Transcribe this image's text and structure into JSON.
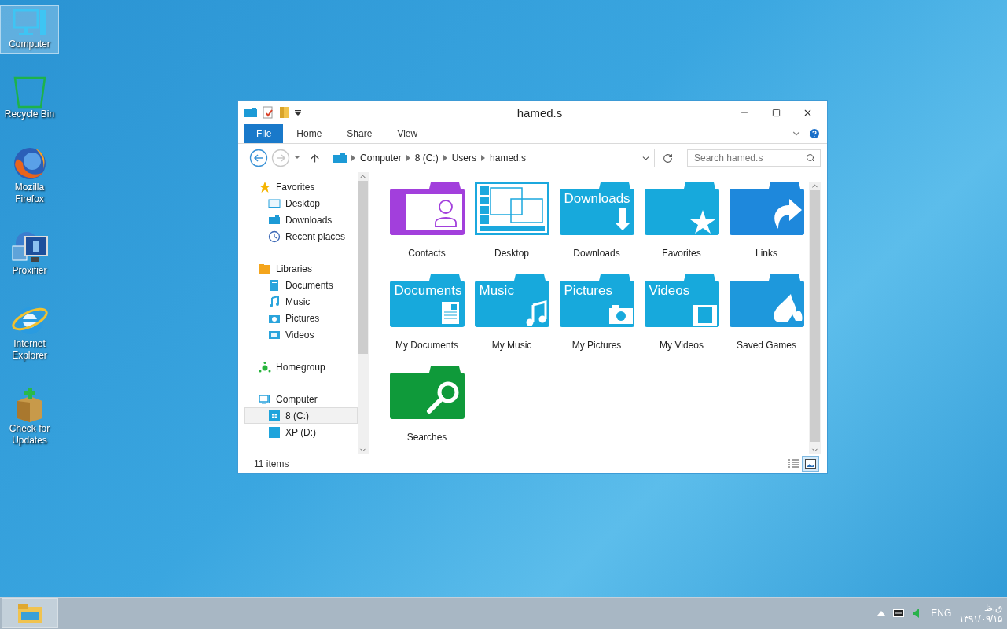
{
  "desktop_icons": [
    {
      "label": "Computer",
      "kind": "computer",
      "selected": true
    },
    {
      "label": "Recycle Bin",
      "kind": "recycle",
      "selected": false
    },
    {
      "label": "Mozilla Firefox",
      "kind": "firefox",
      "selected": false
    },
    {
      "label": "Proxifier",
      "kind": "proxifier",
      "selected": false
    },
    {
      "label": "Internet Explorer",
      "kind": "ie",
      "selected": false
    },
    {
      "label": "Check for Updates",
      "kind": "updates",
      "selected": false
    }
  ],
  "window": {
    "title": "hamed.s",
    "ribbon_tabs": [
      {
        "label": "File",
        "selected": true
      },
      {
        "label": "Home",
        "selected": false
      },
      {
        "label": "Share",
        "selected": false
      },
      {
        "label": "View",
        "selected": false
      }
    ],
    "address": {
      "crumbs": [
        "Computer",
        "8 (C:)",
        "Users",
        "hamed.s"
      ]
    },
    "search": {
      "placeholder": "Search hamed.s"
    },
    "nav": [
      {
        "label": "Favorites",
        "kind": "favorites",
        "selected": false,
        "children": [
          {
            "label": "Desktop",
            "kind": "desktop",
            "selected": false
          },
          {
            "label": "Downloads",
            "kind": "downloads",
            "selected": false
          },
          {
            "label": "Recent places",
            "kind": "recent",
            "selected": false
          }
        ]
      },
      {
        "label": "Libraries",
        "kind": "libraries",
        "selected": false,
        "children": [
          {
            "label": "Documents",
            "kind": "documents",
            "selected": false
          },
          {
            "label": "Music",
            "kind": "music",
            "selected": false
          },
          {
            "label": "Pictures",
            "kind": "pictures",
            "selected": false
          },
          {
            "label": "Videos",
            "kind": "videos",
            "selected": false
          }
        ]
      },
      {
        "label": "Homegroup",
        "kind": "homegroup",
        "selected": false
      },
      {
        "label": "Computer",
        "kind": "computer",
        "selected": false,
        "children": [
          {
            "label": "8 (C:)",
            "kind": "windows-drive",
            "selected": true
          },
          {
            "label": "XP (D:)",
            "kind": "drive",
            "selected": false
          }
        ]
      }
    ],
    "items": [
      {
        "label": "Contacts",
        "kind": "contacts",
        "color": "#a23fdc"
      },
      {
        "label": "Desktop",
        "kind": "desktop",
        "color": "#1ba8de"
      },
      {
        "label": "Downloads",
        "kind": "downloads",
        "color": "#17a9dc",
        "folder_text": "Downloads"
      },
      {
        "label": "Favorites",
        "kind": "favorites",
        "color": "#17a9dc"
      },
      {
        "label": "Links",
        "kind": "links",
        "color": "#1e88dc"
      },
      {
        "label": "My Documents",
        "kind": "documents",
        "color": "#17a9dc",
        "folder_text": "Documents"
      },
      {
        "label": "My Music",
        "kind": "music",
        "color": "#17a9dc",
        "folder_text": "Music"
      },
      {
        "label": "My Pictures",
        "kind": "pictures",
        "color": "#17a9dc",
        "folder_text": "Pictures"
      },
      {
        "label": "My Videos",
        "kind": "videos",
        "color": "#17a9dc",
        "folder_text": "Videos"
      },
      {
        "label": "Saved Games",
        "kind": "games",
        "color": "#1e98dc"
      },
      {
        "label": "Searches",
        "kind": "searches",
        "color": "#0f9a3a"
      }
    ],
    "status": "11 items",
    "views": [
      {
        "kind": "details",
        "selected": false
      },
      {
        "kind": "large-icons",
        "selected": true
      }
    ]
  },
  "taskbar": {
    "tray": {
      "language": "ENG",
      "clock_top": "ق.ظ",
      "clock_date": "۱۳۹۱/۰۹/۱۵"
    }
  }
}
